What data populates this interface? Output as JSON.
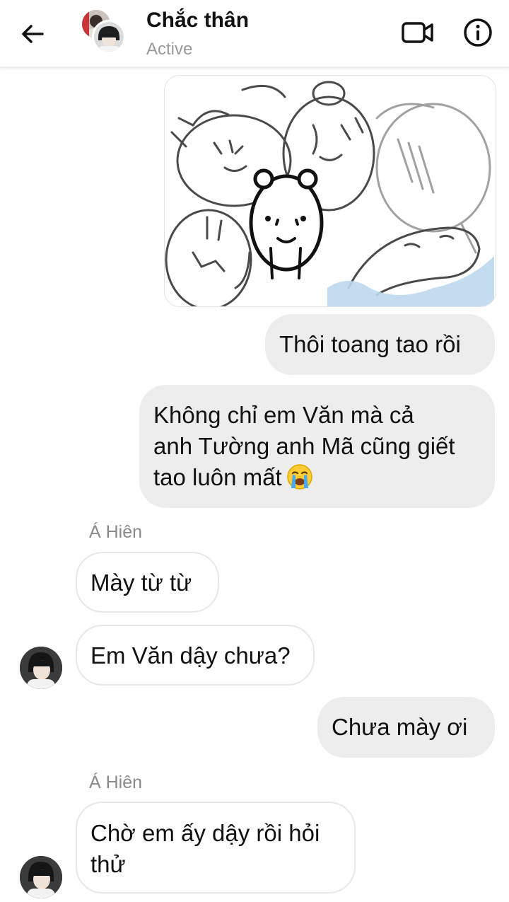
{
  "header": {
    "title": "Chắc thân",
    "status": "Active",
    "back_icon": "arrow-left-icon",
    "video_icon": "video-camera-icon",
    "info_icon": "info-circle-icon"
  },
  "messages": [
    {
      "kind": "sticker",
      "direction": "outgoing",
      "icon": "hamster-sticker"
    },
    {
      "kind": "text",
      "direction": "outgoing",
      "text": "Thôi toang tao rồi"
    },
    {
      "kind": "text",
      "direction": "outgoing",
      "text_lines": [
        "Không chỉ em Văn mà cả",
        "anh Tường anh Mã cũng giết",
        "tao luôn mất"
      ],
      "emoji": "loudly-crying-face-icon"
    },
    {
      "kind": "name",
      "text": "Á Hiên"
    },
    {
      "kind": "text",
      "direction": "incoming",
      "text": "Mày từ từ"
    },
    {
      "kind": "text",
      "direction": "incoming",
      "text": "Em Văn dậy chưa?"
    },
    {
      "kind": "text",
      "direction": "outgoing",
      "text": "Chưa mày ơi"
    },
    {
      "kind": "name",
      "text": "Á Hiên"
    },
    {
      "kind": "text",
      "direction": "incoming",
      "text_lines": [
        "Chờ em ấy dậy rồi hỏi",
        "thử"
      ]
    }
  ],
  "colors": {
    "outgoing_bubble": "#ededed",
    "incoming_bubble": "#ffffff",
    "secondary_text": "#9a9a9a"
  }
}
